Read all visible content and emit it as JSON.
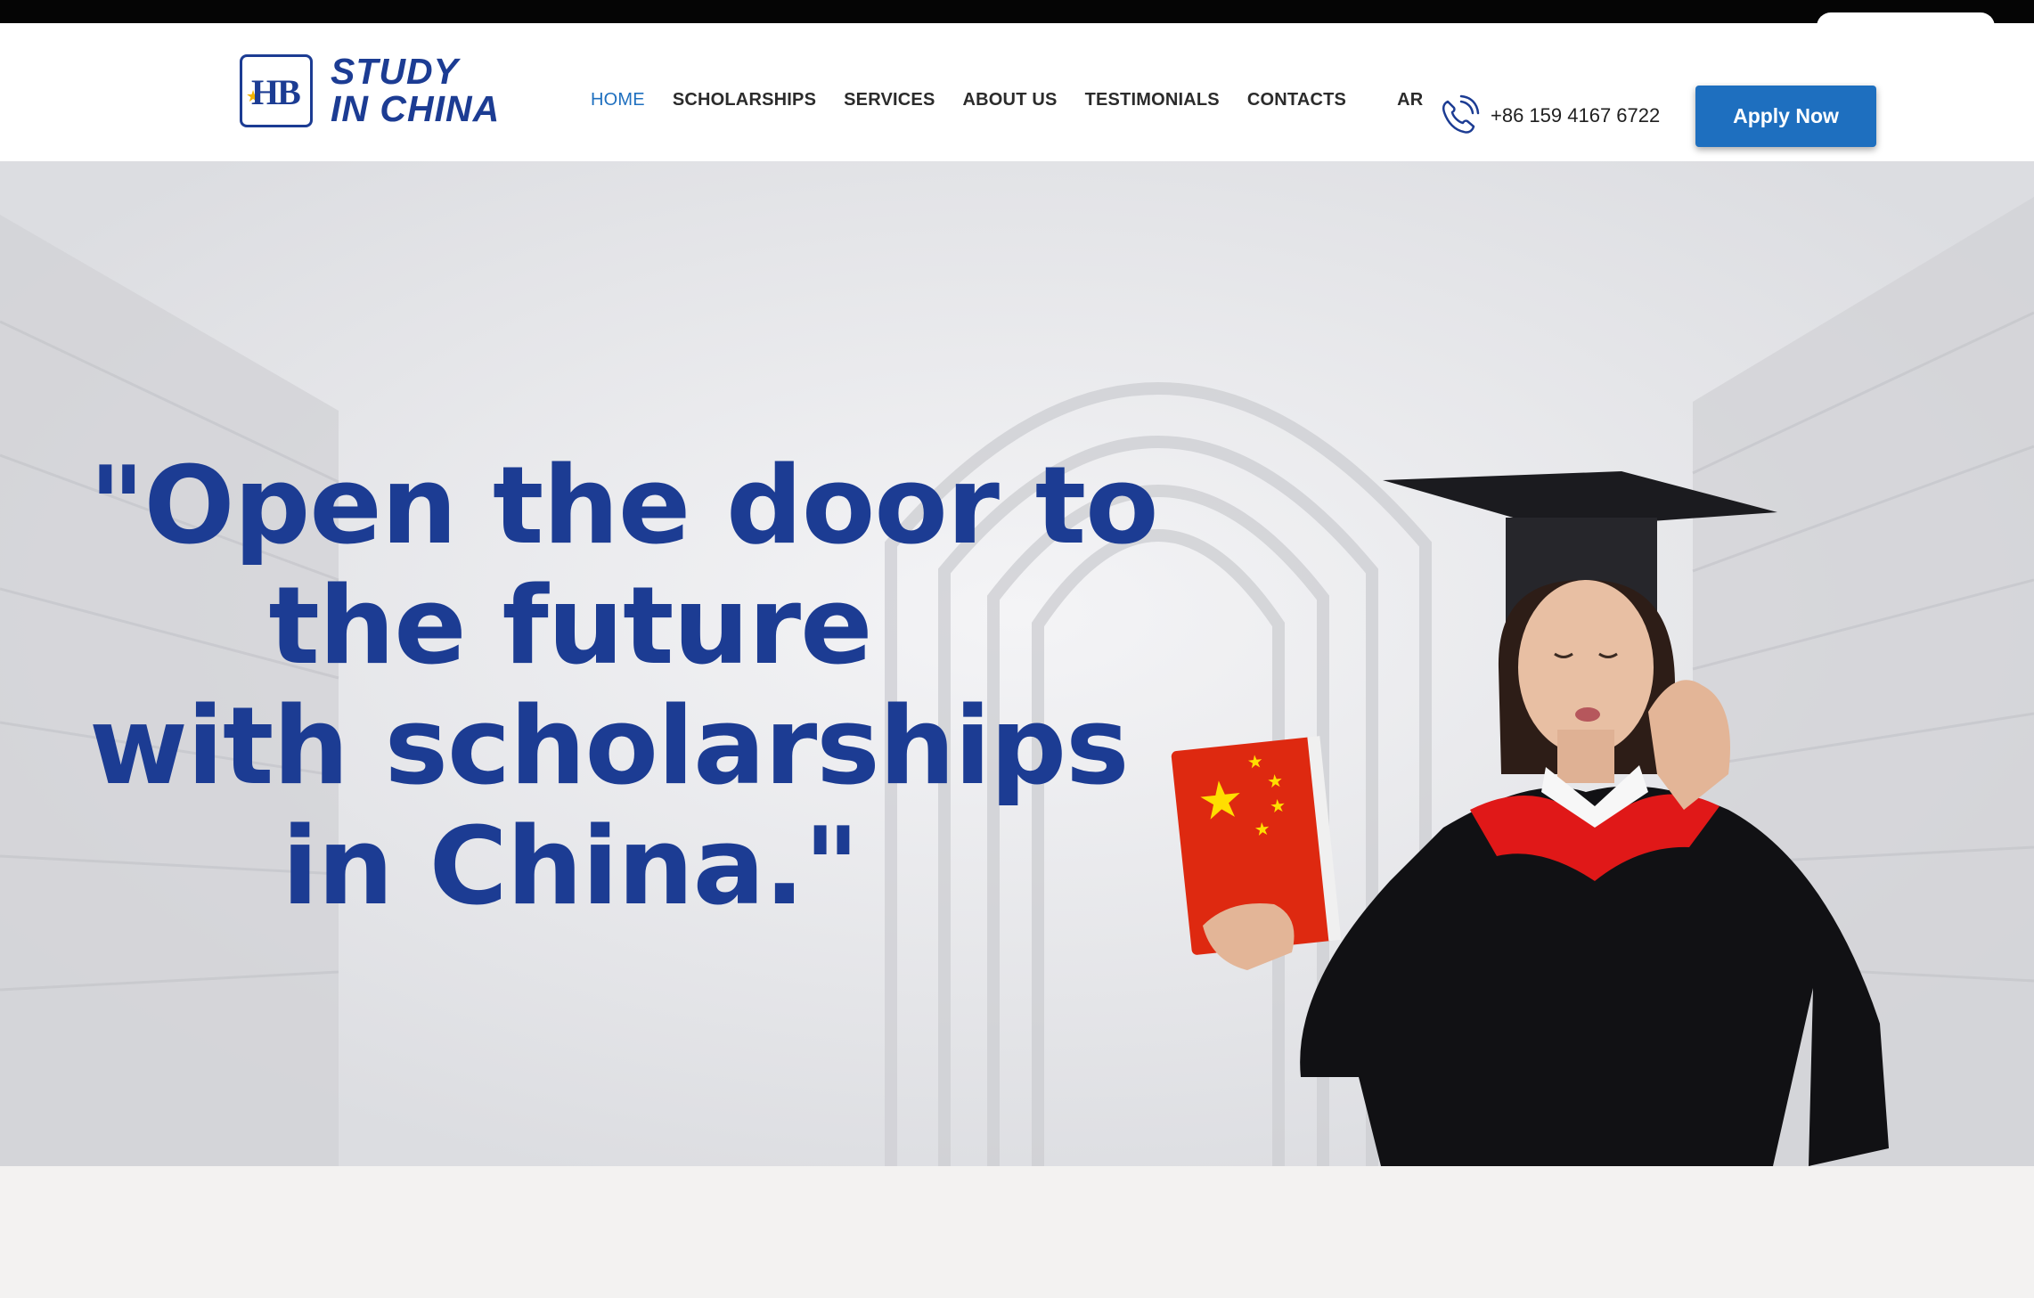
{
  "header": {
    "logo": {
      "badge_text": "HB",
      "title_line1": "STUDY",
      "title_line2": "IN CHINA"
    },
    "nav": [
      {
        "label": "HOME",
        "active": true
      },
      {
        "label": "SCHOLARSHIPS"
      },
      {
        "label": "SERVICES"
      },
      {
        "label": "ABOUT US"
      },
      {
        "label": "TESTIMONIALS"
      },
      {
        "label": "CONTACTS"
      },
      {
        "label": "AR"
      }
    ],
    "phone": "+86 159 4167 6722",
    "phone_icon": "phone-icon",
    "apply_label": "Apply Now"
  },
  "hero": {
    "headline_lines": [
      "\"Open the door to",
      "the future",
      "with scholarships",
      "in China.\""
    ],
    "background": "library-corridor-image",
    "image": "graduate-with-china-flag-book"
  },
  "colors": {
    "brand_blue": "#1c3c93",
    "accent_blue": "#1e6fbf",
    "flag_red": "#de2910",
    "flag_yellow": "#ffde00"
  }
}
